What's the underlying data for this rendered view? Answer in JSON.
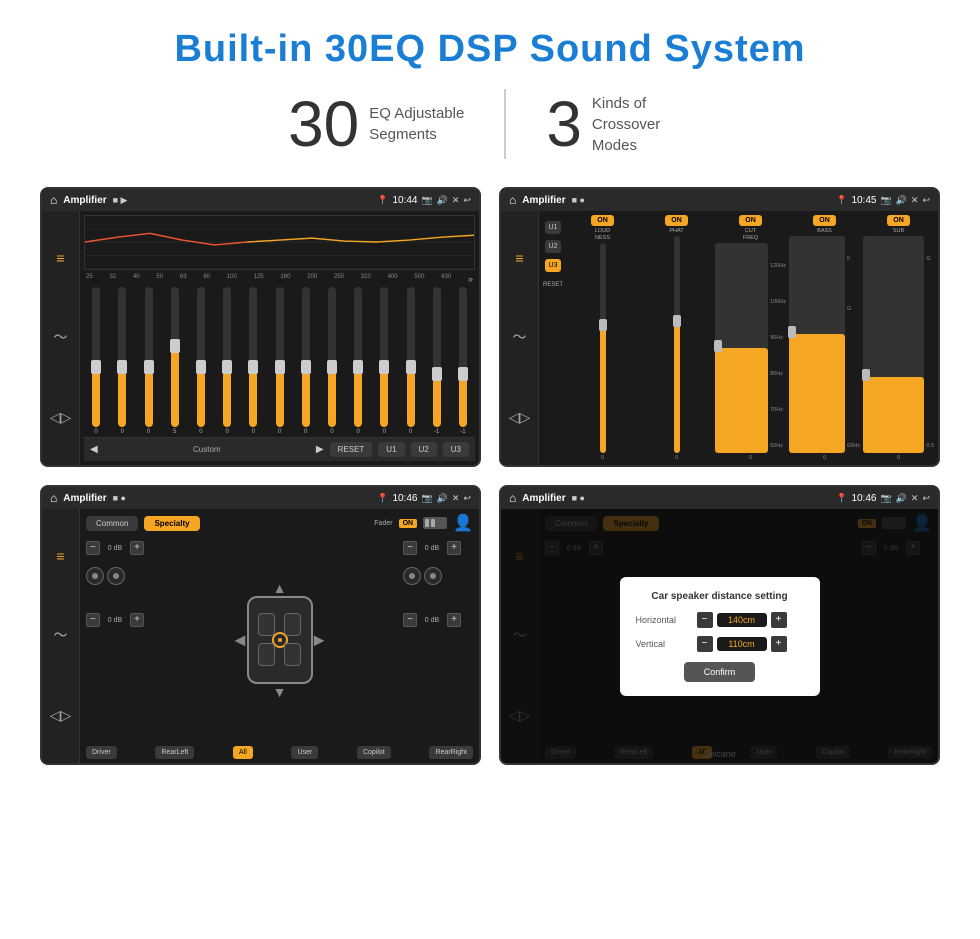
{
  "page": {
    "title": "Built-in 30EQ DSP Sound System",
    "title_color": "#1a7fd4"
  },
  "stats": [
    {
      "number": "30",
      "description": "EQ Adjustable\nSegments"
    },
    {
      "number": "3",
      "description": "Kinds of\nCrossover Modes"
    }
  ],
  "screens": [
    {
      "id": "screen1",
      "status_bar": {
        "title": "Amplifier",
        "time": "10:44"
      },
      "type": "eq",
      "freqs": [
        "25",
        "32",
        "40",
        "50",
        "63",
        "80",
        "100",
        "125",
        "160",
        "200",
        "250",
        "320",
        "400",
        "500",
        "630"
      ],
      "values": [
        "0",
        "0",
        "0",
        "5",
        "0",
        "0",
        "0",
        "0",
        "0",
        "0",
        "0",
        "0",
        "0",
        "-1",
        "0",
        "-1"
      ],
      "preset": "Custom",
      "bottom_buttons": [
        "RESET",
        "U1",
        "U2",
        "U3"
      ]
    },
    {
      "id": "screen2",
      "status_bar": {
        "title": "Amplifier",
        "time": "10:45"
      },
      "type": "crossover",
      "u_buttons": [
        "U1",
        "U2",
        "U3"
      ],
      "active_u": "U3",
      "channels": [
        "LOUDNESS",
        "PHAT",
        "CUT FREQ",
        "BASS",
        "SUB"
      ],
      "channel_on_states": [
        true,
        true,
        true,
        true,
        true
      ],
      "reset_label": "RESET"
    },
    {
      "id": "screen3",
      "status_bar": {
        "title": "Amplifier",
        "time": "10:46"
      },
      "type": "speaker",
      "tabs": [
        "Common",
        "Specialty"
      ],
      "active_tab": "Specialty",
      "fader_label": "Fader",
      "fader_on": "ON",
      "db_values": [
        "0 dB",
        "0 dB",
        "0 dB",
        "0 dB"
      ],
      "bottom_buttons": [
        "Driver",
        "RearLeft",
        "All",
        "User",
        "Copilot",
        "RearRight"
      ],
      "active_bottom": "All"
    },
    {
      "id": "screen4",
      "status_bar": {
        "title": "Amplifier",
        "time": "10:46"
      },
      "type": "speaker_dialog",
      "tabs": [
        "Common",
        "Specialty"
      ],
      "dialog": {
        "title": "Car speaker distance setting",
        "horizontal_label": "Horizontal",
        "horizontal_value": "140cm",
        "vertical_label": "Vertical",
        "vertical_value": "110cm",
        "confirm_label": "Confirm"
      },
      "db_values": [
        "0 dB",
        "0 dB"
      ],
      "bottom_buttons": [
        "Driver",
        "RearLeft",
        "All",
        "User",
        "Copilot",
        "RearRight"
      ]
    }
  ],
  "watermark": "Seicane"
}
